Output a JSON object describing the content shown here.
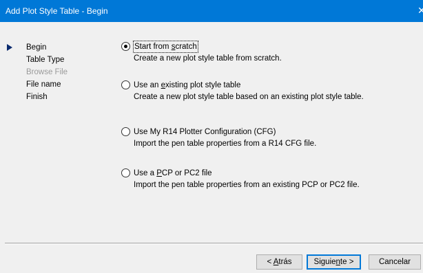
{
  "window": {
    "title": "Add Plot Style Table - Begin",
    "close_glyph": "✕"
  },
  "nav": {
    "items": [
      {
        "label": "Begin",
        "state": "current"
      },
      {
        "label": "Table Type",
        "state": "enabled"
      },
      {
        "label": "Browse File",
        "state": "disabled"
      },
      {
        "label": "File name",
        "state": "enabled"
      },
      {
        "label": "Finish",
        "state": "enabled"
      }
    ]
  },
  "options": [
    {
      "label_pre": "Start from ",
      "label_mnemonic": "s",
      "label_post": "cratch",
      "description": "Create a new plot style table from scratch.",
      "selected": true
    },
    {
      "label_pre": "Use an ",
      "label_mnemonic": "e",
      "label_post": "xisting plot style table",
      "description": "Create a new plot style table based on an existing plot style table.",
      "selected": false
    },
    {
      "label_pre": "Use My R14 Plotter Configuration (CFG)",
      "label_mnemonic": "",
      "label_post": "",
      "description": "Import the pen table properties from a R14 CFG file.",
      "selected": false
    },
    {
      "label_pre": "Use a ",
      "label_mnemonic": "P",
      "label_post": "CP or PC2 file",
      "description": "Import the pen table properties from an existing PCP or PC2 file.",
      "selected": false
    }
  ],
  "buttons": {
    "back_pre": "< ",
    "back_mnemonic": "A",
    "back_post": "trás",
    "next_pre": "Siguie",
    "next_mnemonic": "n",
    "next_post": "te >",
    "cancel": "Cancelar"
  }
}
